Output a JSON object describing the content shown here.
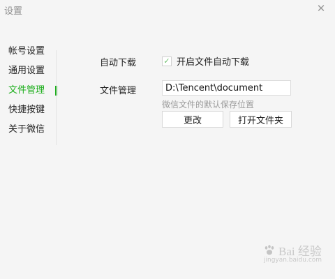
{
  "window": {
    "title": "设置",
    "close_glyph": "✕"
  },
  "sidebar": {
    "items": [
      {
        "label": "帐号设置",
        "active": false
      },
      {
        "label": "通用设置",
        "active": false
      },
      {
        "label": "文件管理",
        "active": true
      },
      {
        "label": "快捷按键",
        "active": false
      },
      {
        "label": "关于微信",
        "active": false
      }
    ]
  },
  "content": {
    "auto_download": {
      "label": "自动下载",
      "checkbox_label": "开启文件自动下载",
      "checked": true,
      "check_glyph": "✓"
    },
    "file_management": {
      "label": "文件管理",
      "path_value": "D:\\Tencent\\document",
      "hint": "微信文件的默认保存位置",
      "change_button": "更改",
      "open_folder_button": "打开文件夹"
    }
  },
  "watermark": {
    "text": "Bai 经验",
    "url": "jingyan.baidu.com"
  },
  "colors": {
    "accent": "#1aad19",
    "muted": "#9b9b9b",
    "background": "#f5f5f5"
  },
  "icons": {
    "close": "close-icon",
    "check": "check-icon",
    "watermark": "paw-icon"
  }
}
